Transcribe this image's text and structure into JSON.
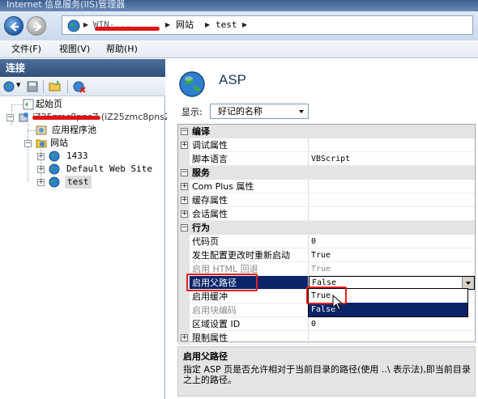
{
  "window": {
    "title": "Internet 信息服务(IIS)管理器"
  },
  "address_bar": {
    "crumbs": [
      "WIN-...",
      "网站",
      "test"
    ]
  },
  "menu": {
    "items": [
      "文件(F)",
      "视图(V)",
      "帮助(H)"
    ]
  },
  "connections": {
    "header": "连接",
    "tree": {
      "start_page": "起始页",
      "server": "iZ25zmc8pnsZ (iZ25zmc8pnsZ",
      "app_pools": "应用程序池",
      "sites": "网站",
      "site_items": [
        "1433",
        "Default Web Site",
        "test"
      ]
    }
  },
  "main": {
    "feature_title": "ASP",
    "display_label": "显示:",
    "display_value": "好记的名称",
    "grid": {
      "cat_compile": "编译",
      "debug_props": "调试属性",
      "script_lang": "脚本语言",
      "script_lang_value": "VBScript",
      "cat_services": "服务",
      "complus_props": "Com Plus 属性",
      "cache_props": "缓存属性",
      "session_props": "会话属性",
      "cat_behavior": "行为",
      "code_page": "代码页",
      "code_page_value": "0",
      "restart_on_config": "发生配置更改时重新启动",
      "restart_on_config_value": "True",
      "enable_html_fallback": "启用 HTML 回退",
      "enable_html_fallback_value": "True",
      "enable_parent_paths": "启用父路径",
      "enable_parent_paths_value": "False",
      "enable_buffering": "启用缓冲",
      "enable_chunked": "启用块编码",
      "locale_id": "区域设置 ID",
      "locale_id_value": "0",
      "limits_props": "限制属性"
    },
    "dropdown_options": [
      "True",
      "False"
    ],
    "dropdown_selected": "False",
    "description": {
      "title": "启用父路径",
      "text": "指定 ASP 页是否允许相对于当前目录的路径(使用 ..\\ 表示法),即当前目录之上的路径。"
    }
  },
  "colors": {
    "selection": "#0a246a",
    "annotation_red": "#e02020",
    "header_blue": "#30517c"
  }
}
